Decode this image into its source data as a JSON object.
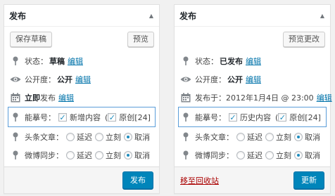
{
  "left": {
    "title": "发布",
    "save_draft": "保存草稿",
    "preview": "预览",
    "status_label": "状态：",
    "status_value": "草稿",
    "visibility_label": "公开度：",
    "visibility_value": "公开",
    "publish_prefix": "立即",
    "publish_label": "发布",
    "edit": "编辑",
    "copyright_label": "能摹号：",
    "copyright_opt1": "新增内容",
    "copyright_opt2": "原创[24]",
    "headline_label": "头条文章：",
    "weibo_label": "微博同步：",
    "radio_delay": "延迟",
    "radio_now": "立刻",
    "radio_cancel": "取消",
    "publish_button": "发布"
  },
  "right": {
    "title": "发布",
    "preview_changes": "预览更改",
    "status_label": "状态：",
    "status_value": "已发布",
    "visibility_label": "公开度：",
    "visibility_value": "公开",
    "published_on": "发布于：2012年1月4日 @ 23:00",
    "edit": "编辑",
    "copyright_label": "能摹号：",
    "copyright_opt1": "历史内容",
    "copyright_opt2": "原创[24]",
    "headline_label": "头条文章：",
    "weibo_label": "微博同步：",
    "radio_delay": "延迟",
    "radio_now": "立刻",
    "radio_cancel": "取消",
    "trash": "移至回收站",
    "update_button": "更新"
  },
  "symbols": {
    "check": "✓",
    "paren_open": "(",
    "toggle": "▲"
  },
  "colors": {
    "link": "#0073aa",
    "primary": "#0085ba",
    "highlight": "#5b9dd9",
    "trash": "#aa0000"
  },
  "icons": [
    "pin-icon",
    "eye-icon",
    "calendar-icon"
  ]
}
